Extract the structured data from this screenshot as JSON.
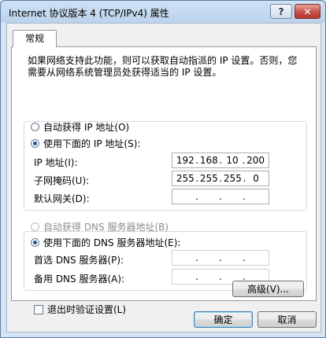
{
  "window": {
    "title": "Internet 协议版本 4 (TCP/IPv4) 属性",
    "help_label": "?",
    "close_label": "✕"
  },
  "tab": {
    "label": "常规"
  },
  "description": "如果网络支持此功能，则可以获取自动指派的 IP 设置。否则，您需要从网络系统管理员处获得适当的 IP 设置。",
  "ip_section": {
    "auto_label": "自动获得 IP 地址(O)",
    "manual_label": "使用下面的 IP 地址(S):",
    "selected": "manual",
    "ip_label": "IP 地址(I):",
    "ip_value": [
      "192",
      "168",
      "10",
      "200"
    ],
    "mask_label": "子网掩码(U):",
    "mask_value": [
      "255",
      "255",
      "255",
      "0"
    ],
    "gateway_label": "默认网关(D):",
    "gateway_value": [
      "",
      "",
      "",
      ""
    ]
  },
  "dns_section": {
    "auto_label": "自动获得 DNS 服务器地址(B)",
    "manual_label": "使用下面的 DNS 服务器地址(E):",
    "selected": "manual",
    "preferred_label": "首选 DNS 服务器(P):",
    "preferred_value": [
      "",
      "",
      "",
      ""
    ],
    "alternate_label": "备用 DNS 服务器(A):",
    "alternate_value": [
      "",
      "",
      "",
      ""
    ]
  },
  "validate_label": "退出时验证设置(L)",
  "advanced_label": "高级(V)...",
  "ok_label": "确定",
  "cancel_label": "取消"
}
